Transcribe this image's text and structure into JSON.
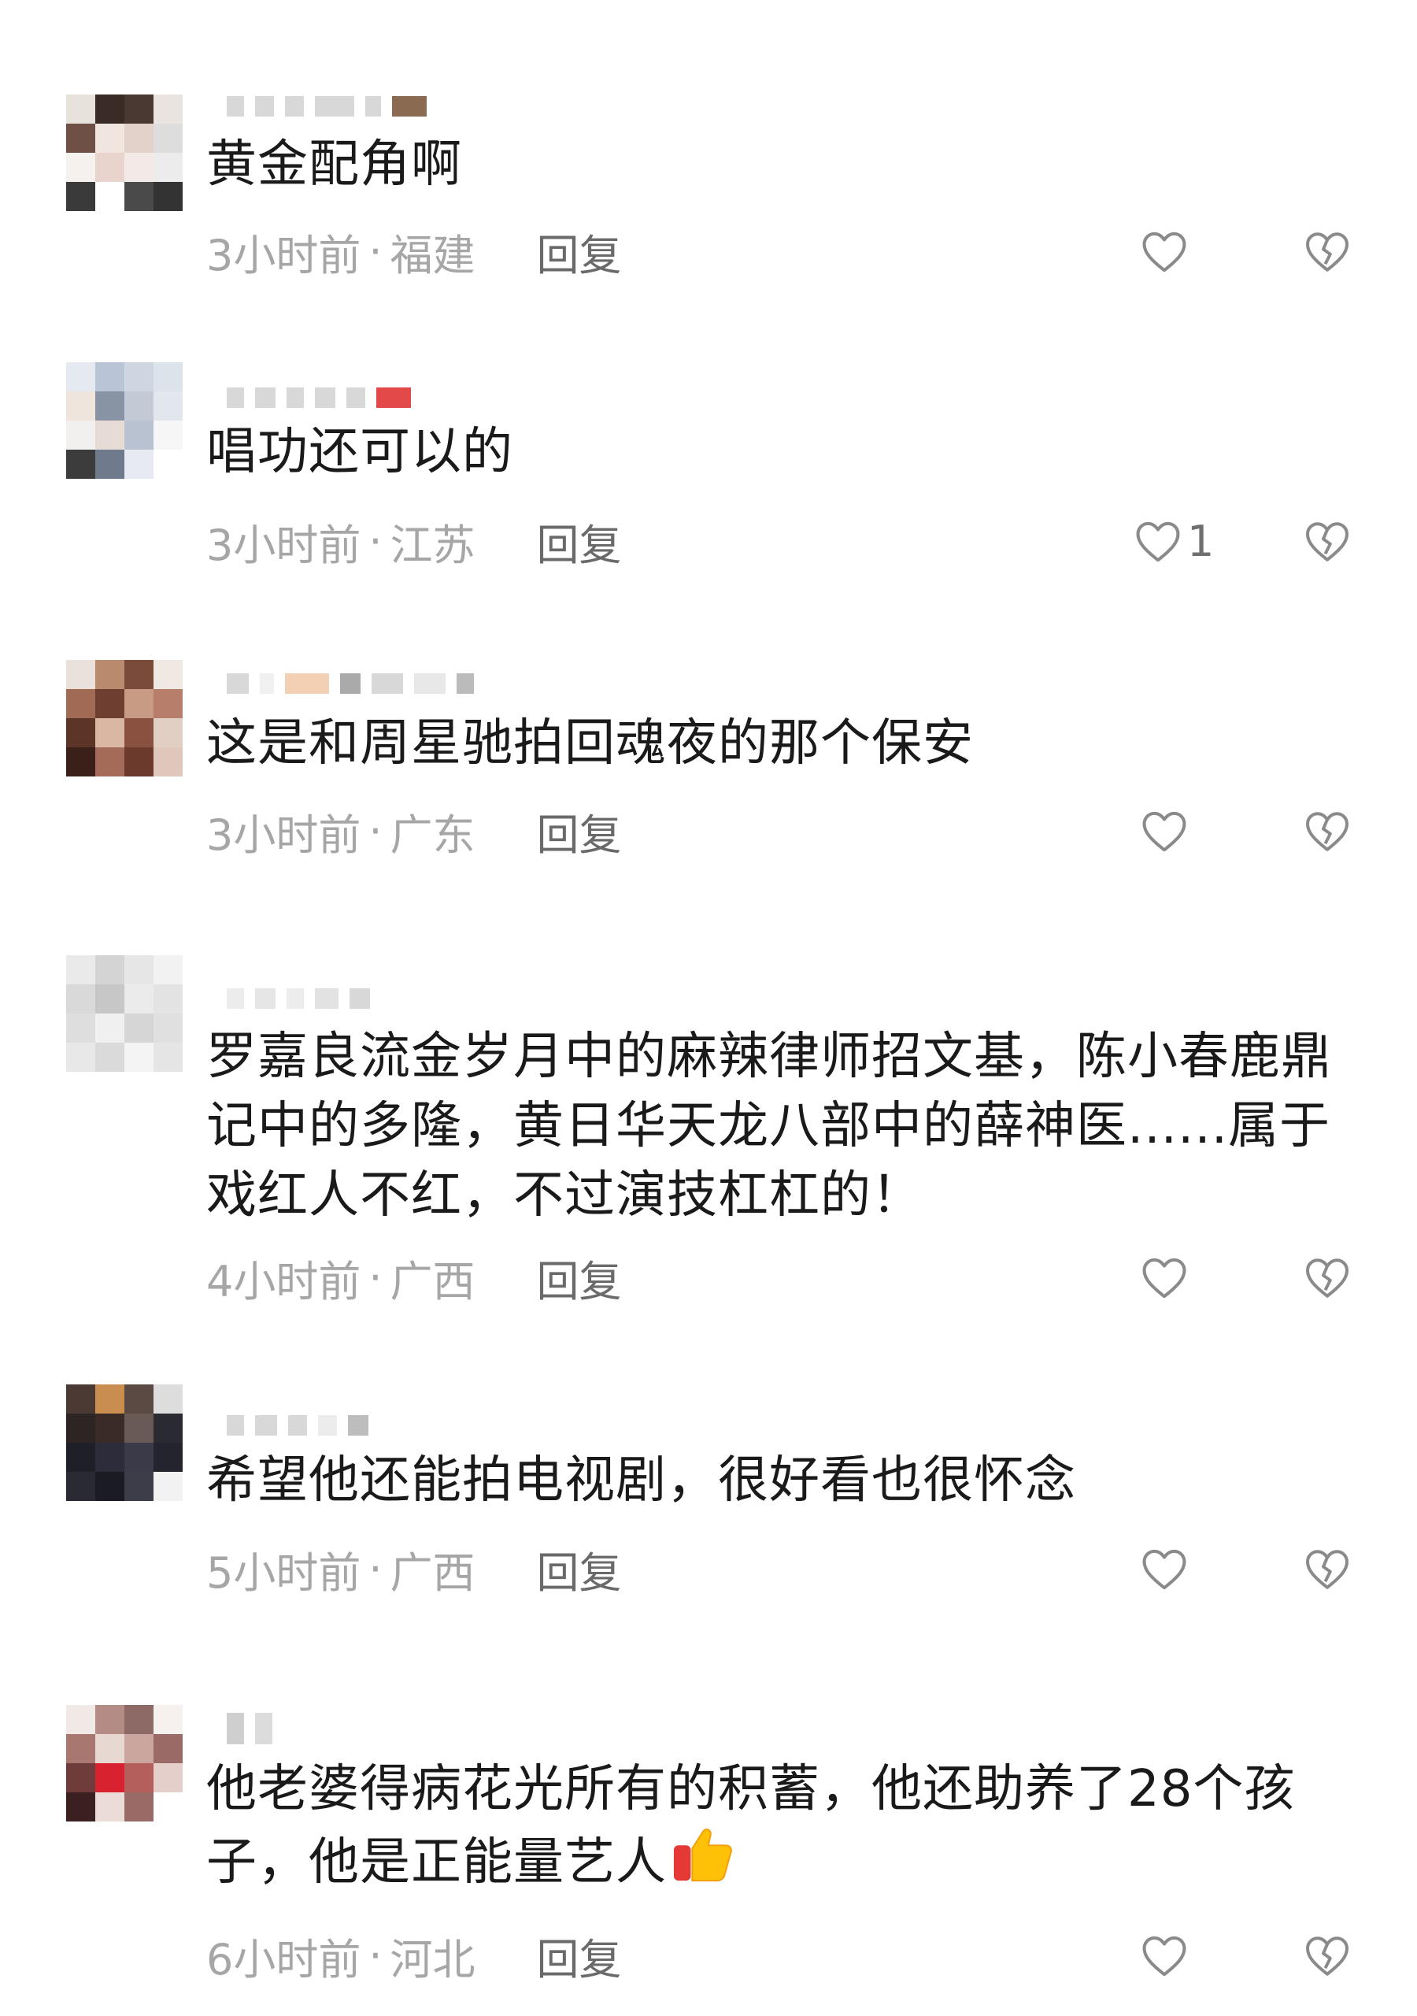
{
  "comments": [
    {
      "text": "黄金配角啊",
      "time": "3小时前",
      "location": "福建",
      "reply_label": "回复",
      "likes": ""
    },
    {
      "text": "唱功还可以的",
      "time": "3小时前",
      "location": "江苏",
      "reply_label": "回复",
      "likes": "1"
    },
    {
      "text": "这是和周星驰拍回魂夜的那个保安",
      "time": "3小时前",
      "location": "广东",
      "reply_label": "回复",
      "likes": ""
    },
    {
      "text": "罗嘉良流金岁月中的麻辣律师招文基，陈小春鹿鼎记中的多隆，黄日华天龙八部中的薛神医......属于戏红人不红，不过演技杠杠的！",
      "time": "4小时前",
      "location": "广西",
      "reply_label": "回复",
      "likes": ""
    },
    {
      "text": "希望他还能拍电视剧，很好看也很怀念",
      "time": "5小时前",
      "location": "广西",
      "reply_label": "回复",
      "likes": ""
    },
    {
      "text": "他老婆得病花光所有的积蓄，他还助养了28个孩子，他是正能量艺人",
      "time": "6小时前",
      "location": "河北",
      "reply_label": "回复",
      "likes": ""
    }
  ],
  "separator": "·",
  "icons": {
    "like": "heart-outline-icon",
    "dislike": "broken-heart-icon",
    "emoji": "thumbs-up-emoji-icon"
  },
  "colors": {
    "text": "#1a1a1a",
    "meta": "#a6a6a6",
    "reply": "#6a6a6a",
    "icon": "#8a8a8a"
  }
}
